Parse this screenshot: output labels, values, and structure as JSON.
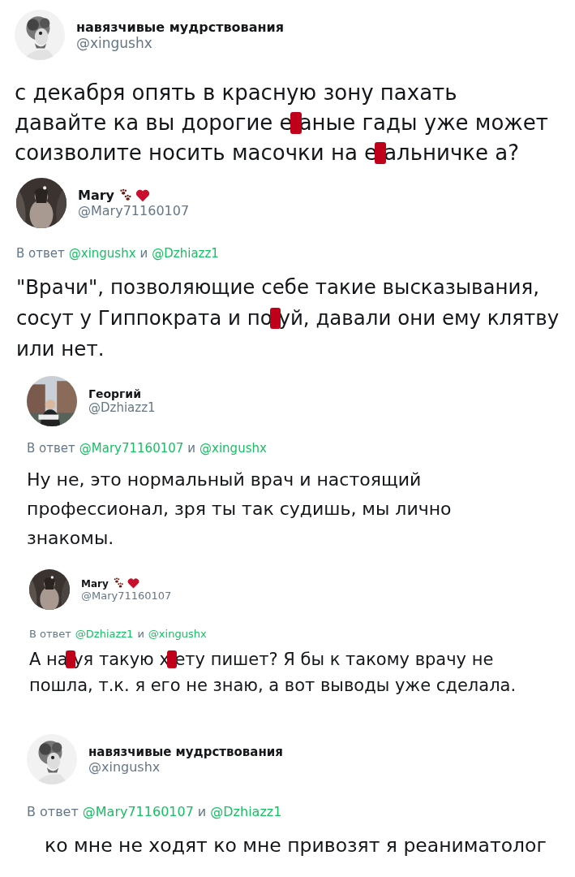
{
  "tweets": [
    {
      "name": "навязчивые мудрствования",
      "handle": "@xingushx",
      "decorated_name": false,
      "lines": [
        [
          {
            "kind": "text",
            "text": "с декабря опять в красную зону пахать"
          }
        ],
        [
          {
            "kind": "text",
            "text": "давайте ка вы дорогие е"
          },
          {
            "kind": "censor"
          },
          {
            "kind": "text",
            "text": "аные гады уже может"
          }
        ],
        [
          {
            "kind": "text",
            "text": "соизволите носить масочки на е"
          },
          {
            "kind": "censor"
          },
          {
            "kind": "text",
            "text": "альничке а?"
          }
        ]
      ]
    },
    {
      "name": "Mary",
      "handle": "@Mary71160107",
      "decorated_name": true,
      "reply": {
        "prefix": "В ответ",
        "mentions": [
          "@xingushx",
          "@Dzhiazz1"
        ],
        "joiner": "и"
      },
      "lines": [
        [
          {
            "kind": "text",
            "text": "\"Врачи\", позволяющие себе такие высказывания,"
          }
        ],
        [
          {
            "kind": "text",
            "text": "сосут у Гиппократа и по"
          },
          {
            "kind": "censor"
          },
          {
            "kind": "text",
            "text": "уй, давали они ему клятву"
          }
        ],
        [
          {
            "kind": "text",
            "text": "или нет."
          }
        ]
      ]
    },
    {
      "name": "Георгий",
      "handle": "@Dzhiazz1",
      "decorated_name": false,
      "reply": {
        "prefix": "В ответ",
        "mentions": [
          "@Mary71160107",
          "@xingushx"
        ],
        "joiner": "и"
      },
      "lines": [
        [
          {
            "kind": "text",
            "text": "Ну не, это нормальный врач и настоящий"
          }
        ],
        [
          {
            "kind": "text",
            "text": "профессионал, зря ты так судишь, мы лично"
          }
        ],
        [
          {
            "kind": "text",
            "text": "знакомы."
          }
        ]
      ]
    },
    {
      "name": "Mary",
      "handle": "@Mary71160107",
      "decorated_name": true,
      "reply": {
        "prefix": "В ответ",
        "mentions": [
          "@Dzhiazz1",
          "@xingushx"
        ],
        "joiner": "и"
      },
      "lines": [
        [
          {
            "kind": "text",
            "text": "А на"
          },
          {
            "kind": "censor"
          },
          {
            "kind": "text",
            "text": "уя такую х"
          },
          {
            "kind": "censor"
          },
          {
            "kind": "text",
            "text": "ету пишет? Я бы к такому врачу не"
          }
        ],
        [
          {
            "kind": "text",
            "text": "пошла, т.к. я его не знаю, а вот выводы уже сделала."
          }
        ]
      ]
    },
    {
      "name": "навязчивые мудрствования",
      "handle": "@xingushx",
      "decorated_name": false,
      "reply": {
        "prefix": "В ответ",
        "mentions": [
          "@Mary71160107",
          "@Dzhiazz1"
        ],
        "joiner": "и"
      },
      "lines": [
        [
          {
            "kind": "text",
            "text": "ко мне не ходят ко мне привозят я реаниматолог"
          }
        ]
      ]
    }
  ]
}
